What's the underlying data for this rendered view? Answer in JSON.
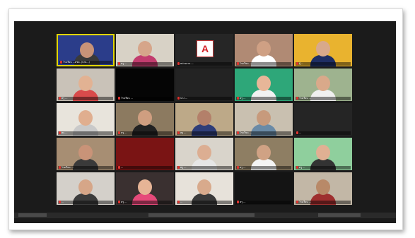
{
  "meeting": {
    "tiles": [
      {
        "label": "โรงเรียน ...ตชด. (นาย...)",
        "bg": "#2b3d8a",
        "skin": "#c89378",
        "shirt": "#3a3a3a",
        "active": true
      },
      {
        "label": "ครู ...",
        "bg": "#d8d2c6",
        "skin": "#d6a58a",
        "shirt": "#c23c6e"
      },
      {
        "label": "หน่วยงาน ...",
        "bg": "#262626",
        "logo": "A"
      },
      {
        "label": "โรงเรียน ...",
        "bg": "#b08a74",
        "skin": "#cfa084",
        "shirt": "#ffffff"
      },
      {
        "label": "ผู้ ...",
        "bg": "#e9b32f",
        "skin": "#d8a98b",
        "shirt": "#1e2e63"
      },
      {
        "label": "ครู ...",
        "bg": "#c9c2b8",
        "skin": "#e2b293",
        "shirt": "#d94b4b"
      },
      {
        "label": "โรงเรียน ...",
        "bg": "#050505",
        "blank": true
      },
      {
        "label": "นาง ...",
        "bg": "#232323",
        "blank": true
      },
      {
        "label": "ครู ...",
        "bg": "#2ea779",
        "skin": "#e7b698",
        "shirt": "#f2f2f2"
      },
      {
        "label": "โรงเรียน ...",
        "bg": "#9eb38f",
        "skin": "#d9a98a",
        "shirt": "#f0f0f0"
      },
      {
        "label": "ครู ...",
        "bg": "#e8e4dc",
        "skin": "#e0ae8f",
        "shirt": "#c9c9c9"
      },
      {
        "label": "ครู ...",
        "bg": "#8c7a60",
        "skin": "#cf9e80",
        "shirt": "#222222"
      },
      {
        "label": "ครู ...",
        "bg": "#bda988",
        "skin": "#b3806a",
        "shirt": "#2e3d78"
      },
      {
        "label": "โรงเรียน ...",
        "bg": "#c9c0b0",
        "skin": "#c79a7c",
        "shirt": "#6a8aa6"
      },
      {
        "label": "...",
        "bg": "#252525",
        "blank": true
      },
      {
        "label": "โรงเรียน ...",
        "bg": "#a78e73",
        "skin": "#c99378",
        "shirt": "#3a3a3a"
      },
      {
        "label": "...",
        "bg": "#7a1414",
        "blank": true
      },
      {
        "label": "ครู ...",
        "bg": "#d9d4cb",
        "skin": "#dcae92",
        "shirt": "#e6e6e6"
      },
      {
        "label": "ครู ...",
        "bg": "#8e7e63",
        "skin": "#d0a284",
        "shirt": "#f4f4f4"
      },
      {
        "label": "ครู ...",
        "bg": "#8fcf9d",
        "skin": "#e0b093",
        "shirt": "#333333"
      },
      {
        "label": "...",
        "bg": "#d4d0ca",
        "skin": "#d6a688",
        "shirt": "#3c3c3c"
      },
      {
        "label": "ครู ...",
        "bg": "#3a3030",
        "skin": "#e6b496",
        "shirt": "#e64a7a"
      },
      {
        "label": "...",
        "bg": "#e7e2da",
        "skin": "#d8aa8c",
        "shirt": "#3a3a3a"
      },
      {
        "label": "ครู ...",
        "bg": "#141414",
        "blank": true
      },
      {
        "label": "โรงเรียน ...",
        "bg": "#c2b7a6",
        "skin": "#b88968",
        "shirt": "#9e2f2f"
      }
    ]
  }
}
